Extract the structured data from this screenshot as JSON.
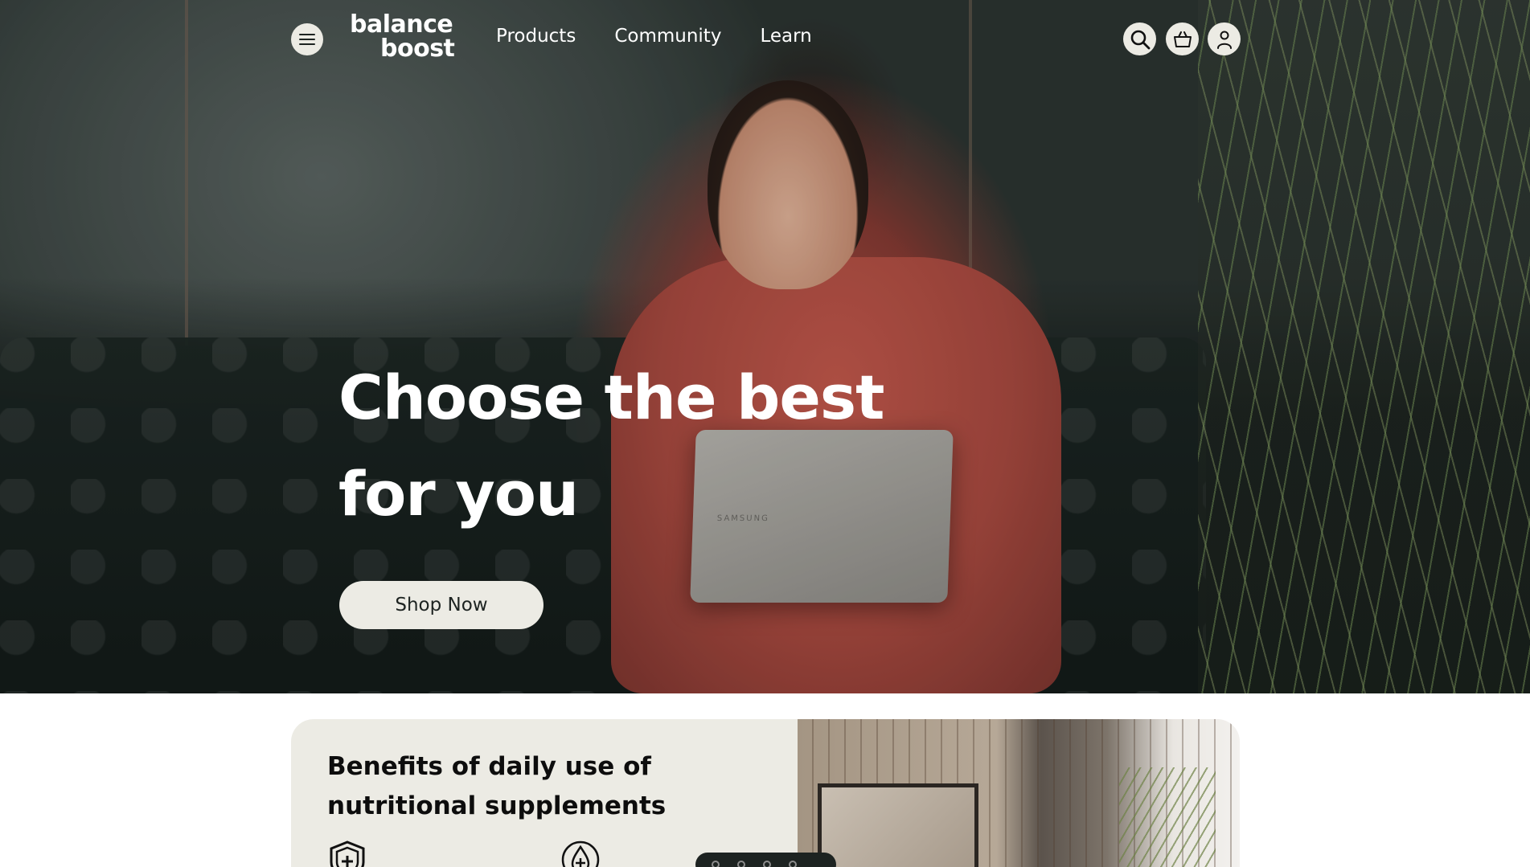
{
  "brand": {
    "logo_line1": "balance",
    "logo_line2": "boost"
  },
  "nav": {
    "menu_icon": "hamburger-menu-icon",
    "links": [
      {
        "label": "Products"
      },
      {
        "label": "Community"
      },
      {
        "label": "Learn"
      }
    ],
    "icons": [
      "search-icon",
      "basket-icon",
      "user-icon"
    ]
  },
  "hero": {
    "title_line1": "Choose the best",
    "title_line2": "for you",
    "cta_label": "Shop Now",
    "laptop_brand": "SAMSUNG"
  },
  "benefits": {
    "title": "Benefits of daily use of nutritional supplements",
    "icons": [
      "shield-plus-icon",
      "drop-plus-icon"
    ]
  },
  "colors": {
    "accent_light": "#ecebe4",
    "dark": "#1d2321",
    "text_white": "#ffffff"
  }
}
